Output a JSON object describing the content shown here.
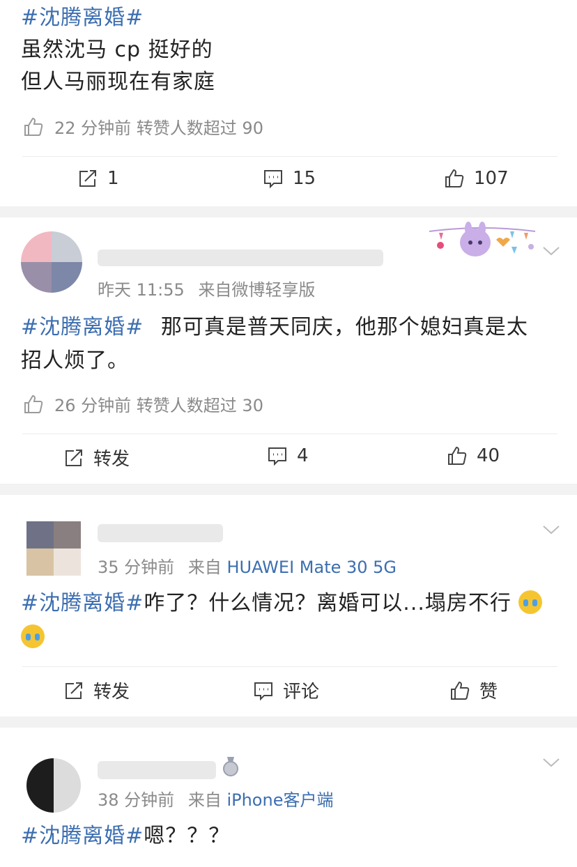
{
  "post1": {
    "hashtag": "#沈腾离婚#",
    "line1": "虽然沈马 cp 挺好的",
    "line2": "但人马丽现在有家庭",
    "meta": "22 分钟前  转赞人数超过 90",
    "repost": "1",
    "comment": "15",
    "like": "107"
  },
  "post2": {
    "time": "昨天 11:55",
    "source": "来自微博轻享版",
    "hashtag": "#沈腾离婚#",
    "body_line1": "那可真是普天同庆，他那个媳妇真是太",
    "body_line2": "招人烦了。",
    "meta": "26 分钟前  转赞人数超过 30",
    "repost": "转发",
    "comment": "4",
    "like": "40"
  },
  "post3": {
    "time": "35 分钟前",
    "source_prefix": "来自",
    "source_device": "HUAWEI Mate 30 5G",
    "hashtag": "#沈腾离婚#",
    "body": "咋了？什么情况？离婚可以...塌房不行",
    "repost": "转发",
    "comment": "评论",
    "like": "赞"
  },
  "post4": {
    "time": "38 分钟前",
    "source_prefix": "来自",
    "source_device": "iPhone客户端",
    "hashtag": "#沈腾离婚#",
    "body": "嗯？？？"
  },
  "colors": {
    "hashtag": "#3c6eb0",
    "meta": "#8a8a8a",
    "separator": "#f2f2f2"
  },
  "icons": [
    "like-icon",
    "repost-icon",
    "comment-icon",
    "chevron-down-icon",
    "crying-emoji-icon"
  ]
}
